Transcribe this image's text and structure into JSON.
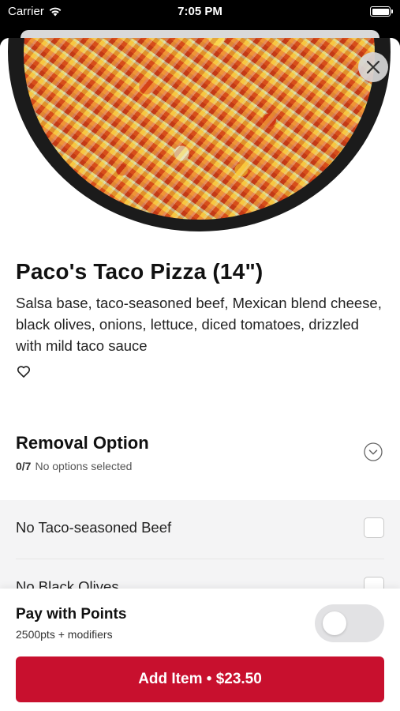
{
  "status_bar": {
    "carrier": "Carrier",
    "time": "7:05 PM"
  },
  "item": {
    "title": "Paco's Taco Pizza (14\")",
    "description": "Salsa base, taco-seasoned beef, Mexican blend cheese, black olives, onions, lettuce, diced tomatoes, drizzled with mild taco sauce"
  },
  "removal_section": {
    "title": "Removal Option",
    "count": "0/7",
    "status": "No options selected",
    "options": [
      {
        "label": "No Taco-seasoned Beef"
      },
      {
        "label": "No Black Olives"
      }
    ]
  },
  "footer": {
    "points_title": "Pay with Points",
    "points_subtitle": "2500pts + modifiers",
    "add_label": "Add Item",
    "separator": "•",
    "price": "$23.50"
  },
  "colors": {
    "brand_red": "#c8102e",
    "toggle_off": "#e2e2e4"
  },
  "icons": [
    "wifi-icon",
    "battery-icon",
    "close-icon",
    "heart-icon",
    "chevron-down-icon"
  ]
}
